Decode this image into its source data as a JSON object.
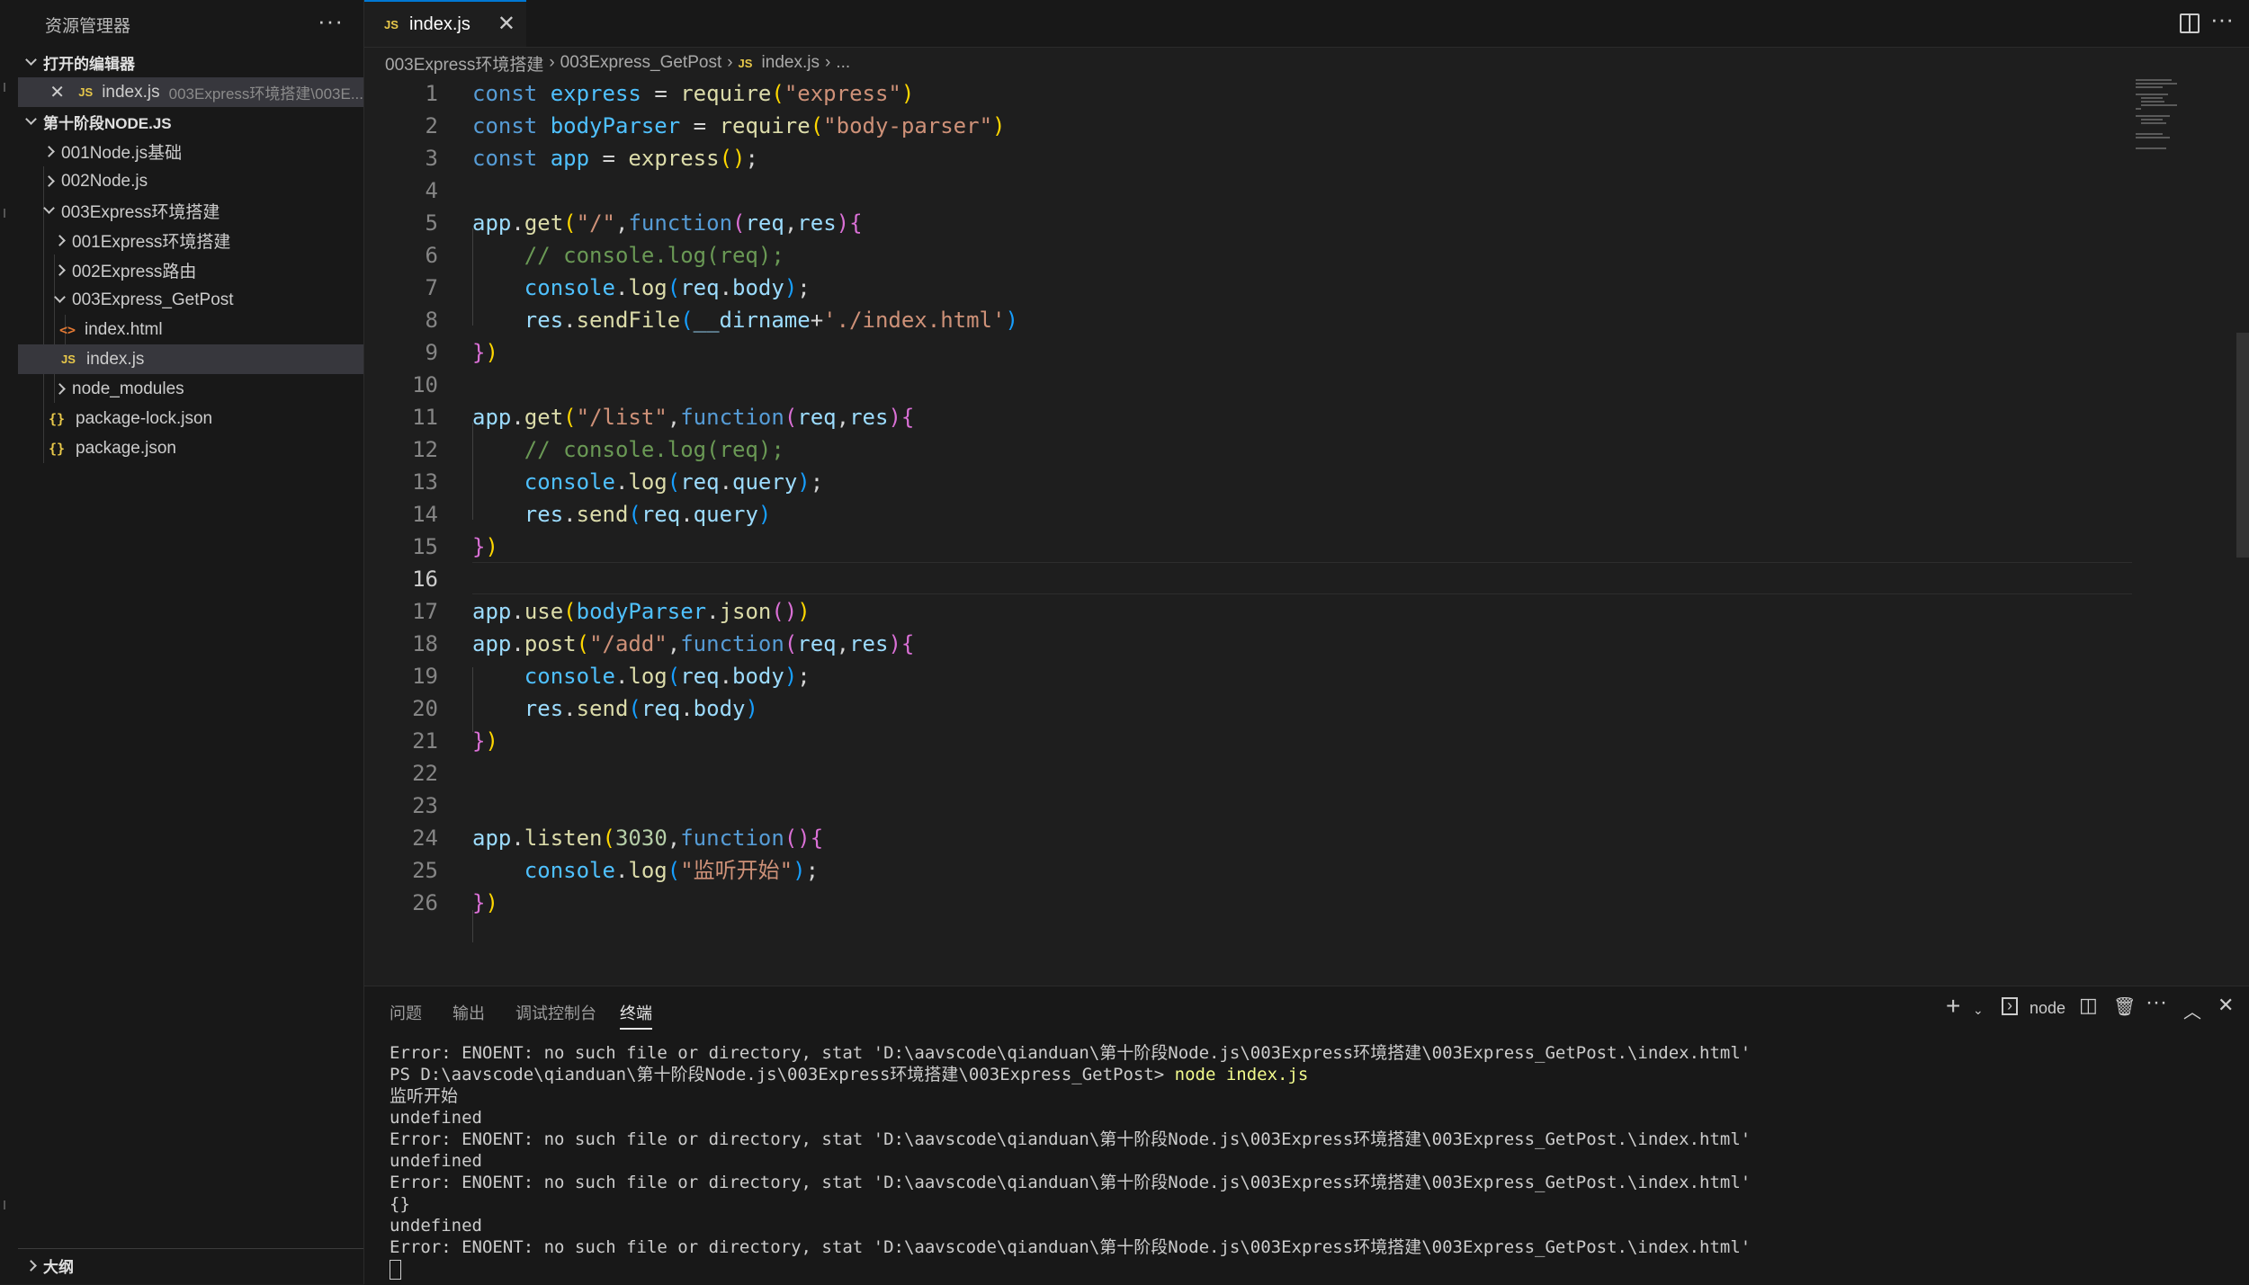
{
  "sidebar": {
    "title": "资源管理器",
    "more": "···",
    "open_editors_label": "打开的编辑器",
    "open_editor": {
      "name": "index.js",
      "path": "003Express环境搭建\\003E..."
    },
    "workspace_label": "第十阶段NODE.JS",
    "tree": [
      {
        "label": "001Node.js基础"
      },
      {
        "label": "002Node.js"
      },
      {
        "label": "003Express环境搭建"
      },
      {
        "label": "001Express环境搭建"
      },
      {
        "label": "002Express路由"
      },
      {
        "label": "003Express_GetPost"
      },
      {
        "label": "index.html"
      },
      {
        "label": "index.js"
      },
      {
        "label": "node_modules"
      },
      {
        "label": "package-lock.json"
      },
      {
        "label": "package.json"
      }
    ],
    "outline_label": "大纲"
  },
  "tab": {
    "label": "index.js",
    "icon": "JS"
  },
  "breadcrumb": [
    "003Express环境搭建",
    "003Express_GetPost",
    "index.js",
    "..."
  ],
  "editor": {
    "line_numbers": [
      "1",
      "2",
      "3",
      "4",
      "5",
      "6",
      "7",
      "8",
      "9",
      "10",
      "11",
      "12",
      "13",
      "14",
      "15",
      "16",
      "17",
      "18",
      "19",
      "20",
      "21",
      "22",
      "23",
      "24",
      "25",
      "26"
    ],
    "current_line": "16"
  },
  "panel": {
    "tabs": [
      "问题",
      "输出",
      "调试控制台",
      "终端"
    ],
    "active_tab": "终端",
    "terminal_name": "node",
    "terminal_lines": [
      "Error: ENOENT: no such file or directory, stat 'D:\\aavscode\\qianduan\\第十阶段Node.js\\003Express环境搭建\\003Express_GetPost.\\index.html'",
      "PS D:\\aavscode\\qianduan\\第十阶段Node.js\\003Express环境搭建\\003Express_GetPost> ",
      "监听开始",
      "undefined",
      "Error: ENOENT: no such file or directory, stat 'D:\\aavscode\\qianduan\\第十阶段Node.js\\003Express环境搭建\\003Express_GetPost.\\index.html'",
      "undefined",
      "Error: ENOENT: no such file or directory, stat 'D:\\aavscode\\qianduan\\第十阶段Node.js\\003Express环境搭建\\003Express_GetPost.\\index.html'",
      "{}",
      "undefined",
      "Error: ENOENT: no such file or directory, stat 'D:\\aavscode\\qianduan\\第十阶段Node.js\\003Express环境搭建\\003Express_GetPost.\\index.html'"
    ],
    "terminal_command": "node index.js"
  },
  "colors": {
    "accent": "#0078d4",
    "editor_bg": "#1e1e1e",
    "sidebar_bg": "#181818"
  }
}
